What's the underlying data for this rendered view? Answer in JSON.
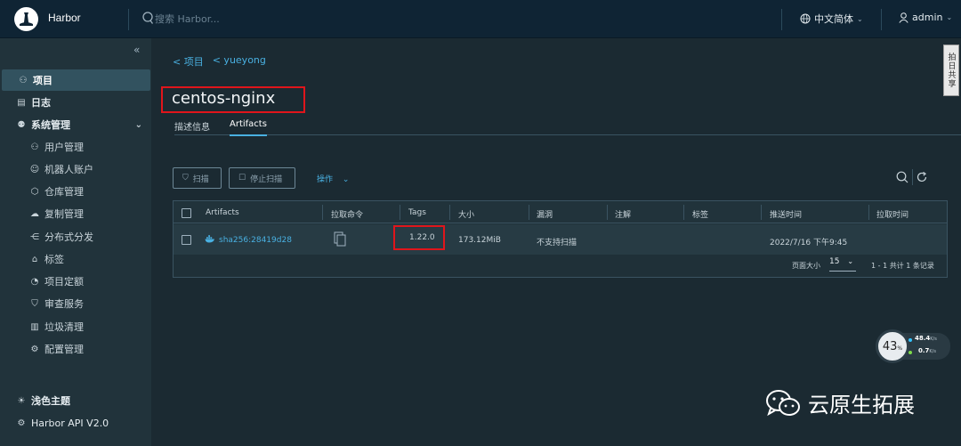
{
  "header": {
    "brand": "Harbor",
    "search_placeholder": "搜索 Harbor...",
    "language": "中文简体",
    "user": "admin"
  },
  "sidebar": {
    "items": [
      {
        "label": "项目",
        "icon": "projects-icon"
      },
      {
        "label": "日志",
        "icon": "logs-icon"
      },
      {
        "label": "系统管理",
        "icon": "admin-icon"
      },
      {
        "label": "用户管理",
        "icon": "users-icon"
      },
      {
        "label": "机器人账户",
        "icon": "robot-icon"
      },
      {
        "label": "仓库管理",
        "icon": "registry-icon"
      },
      {
        "label": "复制管理",
        "icon": "replication-icon"
      },
      {
        "label": "分布式分发",
        "icon": "distribution-icon"
      },
      {
        "label": "标签",
        "icon": "tag-icon"
      },
      {
        "label": "项目定额",
        "icon": "quota-icon"
      },
      {
        "label": "审查服务",
        "icon": "shield-icon"
      },
      {
        "label": "垃圾清理",
        "icon": "trash-icon"
      },
      {
        "label": "配置管理",
        "icon": "gear-icon"
      }
    ],
    "theme": "浅色主题",
    "api": "Harbor API V2.0"
  },
  "main": {
    "breadcrumbs": [
      "< 项目",
      "< yueyong"
    ],
    "title": "centos-nginx",
    "tabs": [
      "描述信息",
      "Artifacts"
    ],
    "toolbar": {
      "scan": "扫描",
      "stop_scan": "停止扫描",
      "actions": "操作"
    },
    "table": {
      "columns": [
        "Artifacts",
        "拉取命令",
        "Tags",
        "大小",
        "漏洞",
        "注解",
        "标签",
        "推送时间",
        "拉取时间"
      ],
      "rows": [
        {
          "artifact": "sha256:28419d28",
          "tags": "1.22.0",
          "size": "173.12MiB",
          "vulnerabilities": "不支持扫描",
          "push_time": "2022/7/16 下午9:45"
        }
      ],
      "footer": {
        "page_size_label": "页面大小",
        "page_size": "15",
        "summary": "1 - 1 共计 1 条记录"
      }
    }
  },
  "side_tab": "拍日共享",
  "speed_widget": {
    "percent": "43",
    "percent_unit": "%",
    "up": "48.4",
    "up_unit": "K/s",
    "down": "0.7",
    "down_unit": "K/s"
  },
  "watermark": "云原生拓展",
  "colors": {
    "accent": "#49b0e1",
    "highlight": "#e0151b"
  }
}
